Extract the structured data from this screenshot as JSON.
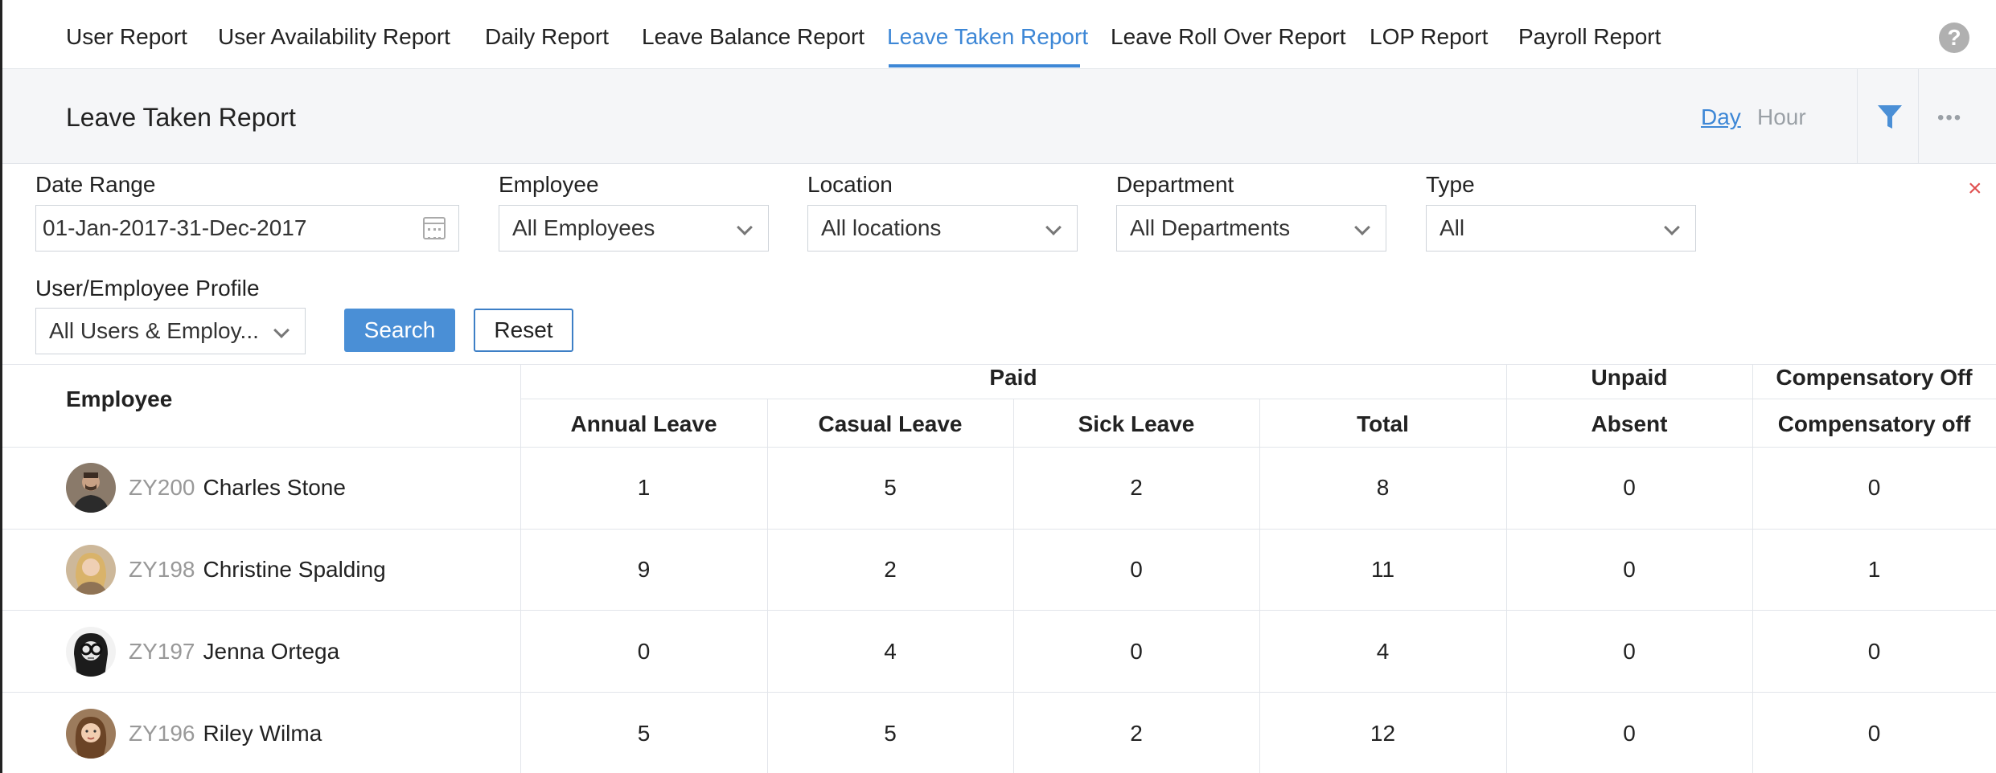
{
  "tabs": [
    {
      "label": "User Report"
    },
    {
      "label": "User Availability Report"
    },
    {
      "label": "Daily Report"
    },
    {
      "label": "Leave Balance Report"
    },
    {
      "label": "Leave Taken Report",
      "active": true
    },
    {
      "label": "Leave Roll Over Report"
    },
    {
      "label": "LOP Report"
    },
    {
      "label": "Payroll Report"
    }
  ],
  "header": {
    "title": "Leave Taken Report",
    "unit_day": "Day",
    "unit_hour": "Hour",
    "help_glyph": "?"
  },
  "filters": {
    "date_range": {
      "label": "Date Range",
      "value": "01-Jan-2017-31-Dec-2017"
    },
    "employee": {
      "label": "Employee",
      "value": "All Employees"
    },
    "location": {
      "label": "Location",
      "value": "All locations"
    },
    "department": {
      "label": "Department",
      "value": "All Departments"
    },
    "type": {
      "label": "Type",
      "value": "All"
    },
    "profile": {
      "label": "User/Employee Profile",
      "value": "All Users & Employ..."
    },
    "search_label": "Search",
    "reset_label": "Reset",
    "close_glyph": "×"
  },
  "table": {
    "employee_header": "Employee",
    "groups": {
      "paid": "Paid",
      "unpaid": "Unpaid",
      "comp": "Compensatory Off"
    },
    "columns": [
      "Annual Leave",
      "Casual Leave",
      "Sick Leave",
      "Total",
      "Absent",
      "Compensatory off"
    ],
    "rows": [
      {
        "id": "ZY200",
        "name": "Charles Stone",
        "values": [
          "1",
          "5",
          "2",
          "8",
          "0",
          "0"
        ]
      },
      {
        "id": "ZY198",
        "name": "Christine Spalding",
        "values": [
          "9",
          "2",
          "0",
          "11",
          "0",
          "1"
        ]
      },
      {
        "id": "ZY197",
        "name": "Jenna Ortega",
        "values": [
          "0",
          "4",
          "0",
          "4",
          "0",
          "0"
        ]
      },
      {
        "id": "ZY196",
        "name": "Riley Wilma",
        "values": [
          "5",
          "5",
          "2",
          "12",
          "0",
          "0"
        ]
      }
    ]
  },
  "colors": {
    "accent": "#3d87d6",
    "button": "#4a8fd6",
    "close": "#e05050"
  }
}
